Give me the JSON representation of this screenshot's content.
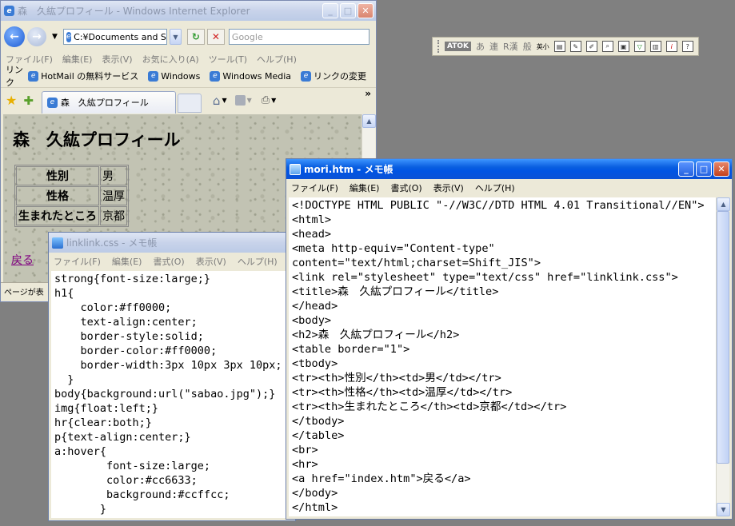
{
  "desktop": {
    "background": "#808080"
  },
  "ie": {
    "title": "森　久紘プロフィール - Windows Internet Explorer",
    "address": "C:¥Documents and S",
    "search_placeholder": "Google",
    "menu": [
      "ファイル(F)",
      "編集(E)",
      "表示(V)",
      "お気に入り(A)",
      "ツール(T)",
      "ヘルプ(H)"
    ],
    "links_label": "リンク",
    "links": [
      "HotMail の無料サービス",
      "Windows",
      "Windows Media",
      "リンクの変更"
    ],
    "tab_label": "森　久紘プロフィール",
    "more_glyph": "»",
    "page": {
      "heading": "森　久紘プロフィール",
      "table": [
        {
          "th": "性別",
          "td": "男"
        },
        {
          "th": "性格",
          "td": "温厚"
        },
        {
          "th": "生まれたところ",
          "td": "京都"
        }
      ],
      "back_link": "戻る"
    },
    "status": "ページが表"
  },
  "atok": {
    "label": "ATOK",
    "modes": [
      "あ",
      "連",
      "R漢",
      "般",
      "英小"
    ]
  },
  "css_notepad": {
    "title": "linklink.css - メモ帳",
    "menu": [
      "ファイル(F)",
      "編集(E)",
      "書式(O)",
      "表示(V)",
      "ヘルプ(H)"
    ],
    "lines": [
      "strong{font-size:large;}",
      "h1{",
      "    color:#ff0000;",
      "    text-align:center;",
      "    border-style:solid;",
      "    border-color:#ff0000;",
      "    border-width:3px 10px 3px 10px;",
      "  }",
      "body{background:url(\"sabao.jpg\");}",
      "img{float:left;}",
      "hr{clear:both;}",
      "p{text-align:center;}",
      "a:hover{",
      "        font-size:large;",
      "        color:#cc6633;",
      "        background:#ccffcc;",
      "       }"
    ]
  },
  "htm_notepad": {
    "title": "mori.htm - メモ帳",
    "menu": [
      "ファイル(F)",
      "編集(E)",
      "書式(O)",
      "表示(V)",
      "ヘルプ(H)"
    ],
    "lines": [
      "<!DOCTYPE HTML PUBLIC \"-//W3C//DTD HTML 4.01 Transitional//EN\">",
      "<html>",
      "<head>",
      "<meta http-equiv=\"Content-type\"",
      "content=\"text/html;charset=Shift_JIS\">",
      "<link rel=\"stylesheet\" type=\"text/css\" href=\"linklink.css\">",
      "<title>森　久紘プロフィール</title>",
      "</head>",
      "<body>",
      "<h2>森　久紘プロフィール</h2>",
      "<table border=\"1\">",
      "<tbody>",
      "<tr><th>性別</th><td>男</td></tr>",
      "<tr><th>性格</th><td>温厚</td></tr>",
      "<tr><th>生まれたところ</th><td>京都</td></tr>",
      "</tbody>",
      "</table>",
      "<br>",
      "<hr>",
      "<a href=\"index.htm\">戻る</a>",
      "</body>",
      "</html>"
    ]
  }
}
